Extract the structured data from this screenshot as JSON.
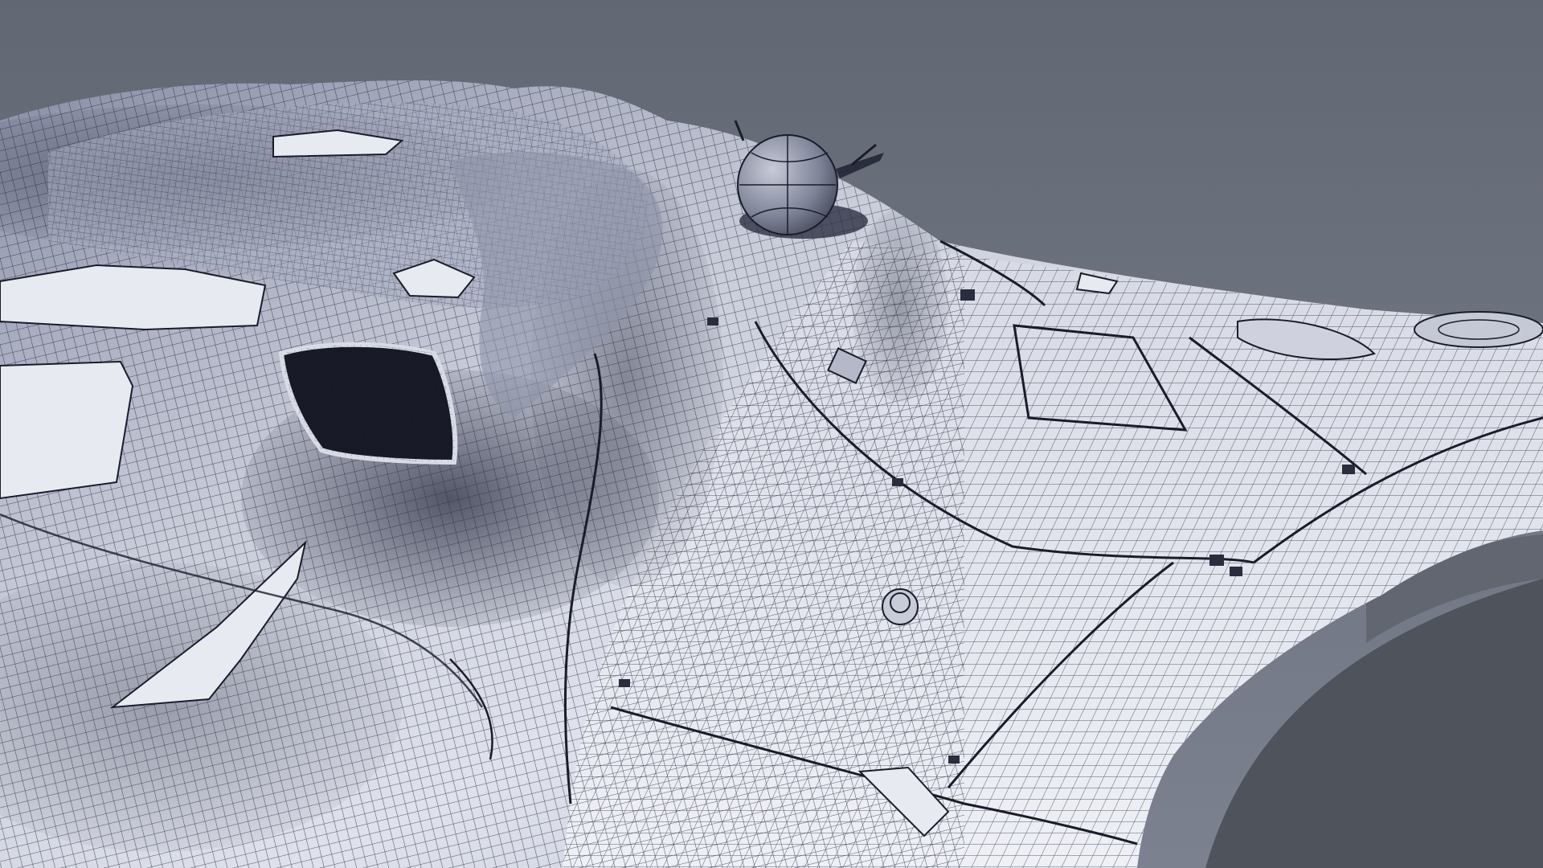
{
  "scene": {
    "subject": "wireframe-spaceship-hull",
    "render_style": "shaded-wireframe",
    "colors": {
      "background_top": "#626873",
      "background_bottom": "#7c8190",
      "ground_shadow": "#4f535c",
      "hull_light": "#e9ebf3",
      "hull_mid": "#aeb3c6",
      "hull_dark": "#3e4358",
      "wire": "#1e2133",
      "deep_shadow": "#1a1c2a"
    }
  }
}
